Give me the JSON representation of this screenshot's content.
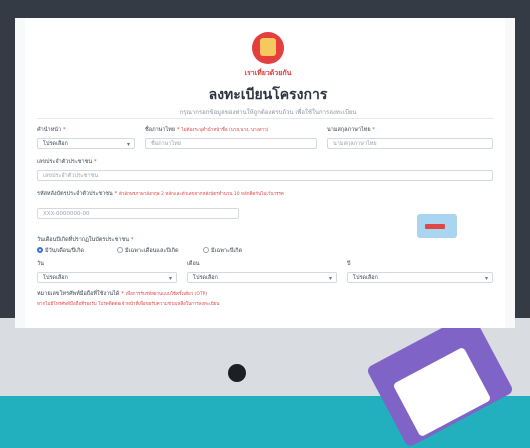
{
  "header": {
    "logo_text": "เราเที่ยวด้วยกัน",
    "title": "ลงทะเบียนโครงการ",
    "subtitle": "กรุณากรอกข้อมูลของท่านให้ถูกต้องครบถ้วน เพื่อใช้ในการลงทะเบียน"
  },
  "form": {
    "prefix": {
      "label": "คำนำหน้า",
      "required": "*",
      "value": "โปรดเลือก"
    },
    "first_name": {
      "label": "ชื่อภาษาไทย",
      "required": "*",
      "hint": "ไม่ต้องระบุคำนำหน้าชื่อ (นาย,นาง, นางสาว)",
      "placeholder": "ชื่อภาษาไทย"
    },
    "last_name": {
      "label": "นามสกุลภาษาไทย",
      "required": "*",
      "placeholder": "นามสกุลภาษาไทย"
    },
    "id_number": {
      "label": "เลขประจำตัวประชาชน",
      "required": "*",
      "placeholder": "เลขประจำตัวประชาชน"
    },
    "laser_code": {
      "label": "รหัสหลังบัตรประจำตัวประชาชน",
      "required": "*",
      "hint": "ตัวอักษรภาษาอังกฤษ 2 หลักและตัวเลขจากหลังบัตรจำนวน 10 หลักติดกันไม่เว้นวรรค",
      "placeholder": "XXX-0000000-00"
    },
    "birthdate": {
      "label": "วันเดือนปีเกิดที่ปรากฏในบัตรประชาชน",
      "required": "*",
      "options": [
        "มีวัน/เดือน/ปีเกิด",
        "มีเฉพาะเดือนและปีเกิด",
        "มีเฉพาะปีเกิด"
      ],
      "selected": 0,
      "day_label": "วัน",
      "month_label": "เดือน",
      "year_label": "ปี",
      "day_value": "โปรดเลือก",
      "month_value": "โปรดเลือก",
      "year_value": "โปรดเลือก"
    },
    "phone": {
      "label": "หมายเลขโทรศัพท์มือถือที่ใช้งานได้",
      "required": "*",
      "hint": "เพื่อการรับรหัสผ่านแบบใช้ครั้งเดียว (OTP)",
      "note": "หากไม่มีโทรศัพท์มือถือที่รองรับ โปรดติดต่อเจ้าหน้าที่เพื่อขอรับความช่วยเหลือในการลงทะเบียน"
    }
  },
  "colors": {
    "background": "#23b0be",
    "title": "#2c3440",
    "required": "#e04646",
    "radio_on": "#3b6fe0"
  }
}
